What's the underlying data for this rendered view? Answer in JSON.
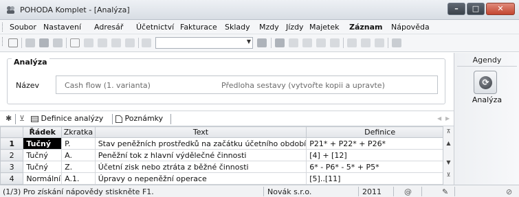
{
  "window": {
    "title": "POHODA Komplet - [Analýza]"
  },
  "menu": {
    "items": [
      {
        "label": "Soubor"
      },
      {
        "label": "Nastavení"
      },
      {
        "label": "Adresář"
      },
      {
        "label": "Účetnictví"
      },
      {
        "label": "Fakturace"
      },
      {
        "label": "Sklady"
      },
      {
        "label": "Mzdy"
      },
      {
        "label": "Jízdy"
      },
      {
        "label": "Majetek"
      },
      {
        "label": "Záznam",
        "bold": true
      },
      {
        "label": "Nápověda"
      }
    ]
  },
  "toolbar": {
    "combo_value": ""
  },
  "form": {
    "group_title": "Analýza",
    "name_label": "Název",
    "name_value": "Cash flow (1. varianta)",
    "name_hint": "Předloha sestavy (vytvořte kopii a upravte)"
  },
  "tabs": [
    {
      "label": "Definice analýzy",
      "icon": "table-icon"
    },
    {
      "label": "Poznámky",
      "icon": "note-icon"
    }
  ],
  "table": {
    "columns": [
      "Řádek",
      "Zkratka",
      "Text",
      "Definice"
    ],
    "rows": [
      {
        "num": "1",
        "radek": "Tučný",
        "zkratka": "P.",
        "text": "Stav peněžních prostředků na začátku účetního období",
        "definice": "P21* + P22* + P26*"
      },
      {
        "num": "2",
        "radek": "Tučný",
        "zkratka": "A.",
        "text": "Peněžní tok z hlavní výdělečné činnosti",
        "definice": "[4] + [12]"
      },
      {
        "num": "3",
        "radek": "Tučný",
        "zkratka": "Z.",
        "text": "Účetní zisk nebo ztráta z běžné činnosti",
        "definice": "6* - P6* - 5* + P5*"
      },
      {
        "num": "4",
        "radek": "Normální",
        "zkratka": "A.1.",
        "text": "Úpravy o nepeněžní operace",
        "definice": "[5]..[11]"
      }
    ]
  },
  "agendy": {
    "header": "Agendy",
    "item_label": "Analýza"
  },
  "status": {
    "help": "(1/3) Pro získání nápovědy stiskněte F1.",
    "company": "Novák s.r.o.",
    "year": "2011"
  }
}
